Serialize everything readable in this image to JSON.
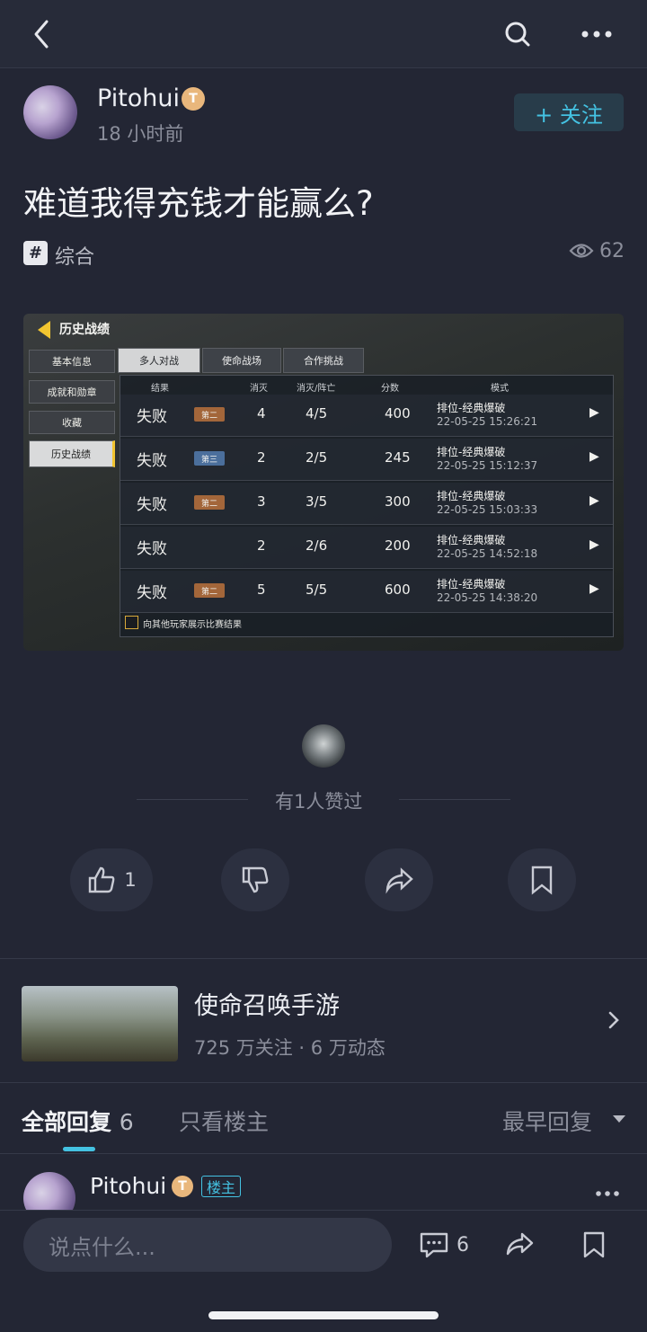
{
  "colors": {
    "background": "#232634",
    "accent": "#44c2e2",
    "text": "#e8e9ee",
    "muted": "#8b8e9b"
  },
  "topbar": {
    "back_icon": "back-arrow-icon",
    "search_icon": "search-icon",
    "more_icon": "more-dots-icon"
  },
  "post": {
    "author": "Pitohui",
    "author_badge": "T",
    "time": "18 小时前",
    "follow_label": "+ 关注",
    "title": "难道我得充钱才能赢么?",
    "tag_symbol": "#",
    "tag": "综合",
    "views": "62"
  },
  "screenshot": {
    "title": "历史战绩",
    "side_menu": [
      "基本信息",
      "成就和勋章",
      "收藏",
      "历史战绩"
    ],
    "tabs": [
      "多人对战",
      "使命战场",
      "合作挑战"
    ],
    "columns": [
      "结果",
      "消灭",
      "消灭/阵亡",
      "分数",
      "模式"
    ],
    "rows": [
      {
        "result": "失败",
        "rank": "第二",
        "kills": "4",
        "kd": "4/5",
        "score": "400",
        "mode": "排位-经典爆破",
        "time": "22-05-25 15:26:21"
      },
      {
        "result": "失败",
        "rank": "第三",
        "kills": "2",
        "kd": "2/5",
        "score": "245",
        "mode": "排位-经典爆破",
        "time": "22-05-25 15:12:37"
      },
      {
        "result": "失败",
        "rank": "第二",
        "kills": "3",
        "kd": "3/5",
        "score": "300",
        "mode": "排位-经典爆破",
        "time": "22-05-25 15:03:33"
      },
      {
        "result": "失败",
        "rank": "",
        "kills": "2",
        "kd": "2/6",
        "score": "200",
        "mode": "排位-经典爆破",
        "time": "22-05-25 14:52:18"
      },
      {
        "result": "失败",
        "rank": "第二",
        "kills": "5",
        "kd": "5/5",
        "score": "600",
        "mode": "排位-经典爆破",
        "time": "22-05-25 14:38:20"
      }
    ],
    "footer": "向其他玩家展示比赛结果"
  },
  "likes": {
    "text": "有1人赞过"
  },
  "actions": {
    "like_count": "1"
  },
  "game": {
    "name": "使命召唤手游",
    "stats": "725 万关注 · 6 万动态"
  },
  "replies": {
    "all_label": "全部回复",
    "all_count": "6",
    "op_only": "只看楼主",
    "sort": "最早回复"
  },
  "comment": {
    "author": "Pitohui",
    "badge": "T",
    "owner_tag": "楼主"
  },
  "bottom": {
    "placeholder": "说点什么...",
    "comment_count": "6"
  }
}
